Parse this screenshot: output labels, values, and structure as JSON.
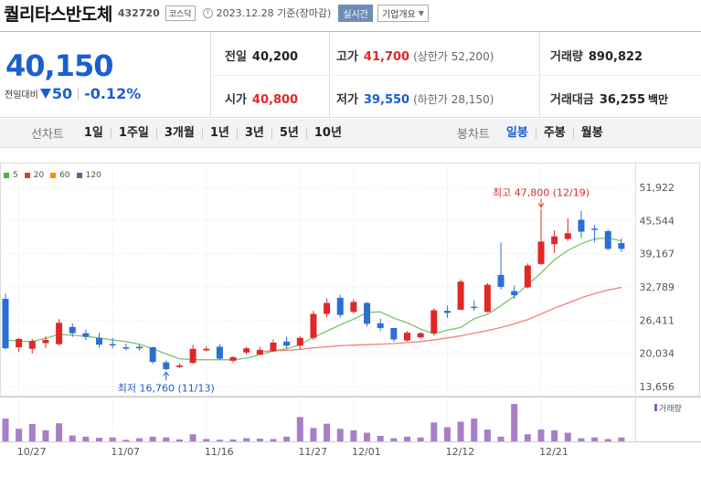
{
  "header": {
    "stock_name": "퀄리타스반도체",
    "stock_code": "432720",
    "market": "코스닥",
    "date_text": "2023.12.28 기준(장마감)",
    "realtime_label": "실시간",
    "company_label": "기업개요"
  },
  "price": {
    "current": "40,150",
    "change_label": "전일대비",
    "change_value": "50",
    "change_pct": "-0.12%"
  },
  "stats": {
    "prev_close_label": "전일",
    "prev_close": "40,200",
    "high_label": "고가",
    "high": "41,700",
    "upper_limit": "(상한가 52,200)",
    "volume_label": "거래량",
    "volume": "890,822",
    "open_label": "시가",
    "open": "40,800",
    "low_label": "저가",
    "low": "39,550",
    "lower_limit": "(하한가 28,150)",
    "amount_label": "거래대금",
    "amount": "36,255",
    "amount_unit": "백만"
  },
  "toolbar": {
    "line_label": "선차트",
    "line_periods": [
      "1일",
      "1주일",
      "3개월",
      "1년",
      "3년",
      "5년",
      "10년"
    ],
    "candle_label": "봉차트",
    "candle_periods": [
      "일봉",
      "주봉",
      "월봉"
    ],
    "active_candle": "일봉"
  },
  "legend": [
    {
      "label": "5",
      "color": "#4caf50"
    },
    {
      "label": "20",
      "color": "#e53935"
    },
    {
      "label": "60",
      "color": "#fb8c00"
    },
    {
      "label": "120",
      "color": "#8e44ad"
    }
  ],
  "colors": {
    "up": "#e02828",
    "down": "#2a6fd6",
    "ma5": "#7ec26b",
    "ma20": "#f08080"
  },
  "chart_data": {
    "type": "candlestick",
    "y_ticks": [
      51922,
      45544,
      39167,
      32789,
      26411,
      20034,
      13656
    ],
    "y_tick_labels": [
      "51,922",
      "45,544",
      "39,167",
      "32,789",
      "26,411",
      "20,034",
      "13,656"
    ],
    "ylim": [
      13656,
      51922
    ],
    "x_labels": [
      {
        "label": "10/27",
        "index": 1
      },
      {
        "label": "11/07",
        "index": 8
      },
      {
        "label": "11/16",
        "index": 15
      },
      {
        "label": "11/27",
        "index": 22
      },
      {
        "label": "12/01",
        "index": 26
      },
      {
        "label": "12/12",
        "index": 33
      },
      {
        "label": "12/21",
        "index": 40
      }
    ],
    "candles": [
      {
        "o": 30500,
        "h": 31500,
        "l": 20800,
        "c": 21000
      },
      {
        "o": 21200,
        "h": 23000,
        "l": 20300,
        "c": 22800
      },
      {
        "o": 20900,
        "h": 22800,
        "l": 20000,
        "c": 22400
      },
      {
        "o": 22000,
        "h": 23300,
        "l": 21000,
        "c": 22600
      },
      {
        "o": 21800,
        "h": 26600,
        "l": 21500,
        "c": 25900
      },
      {
        "o": 25100,
        "h": 25800,
        "l": 23200,
        "c": 23900
      },
      {
        "o": 23900,
        "h": 24600,
        "l": 22600,
        "c": 23200
      },
      {
        "o": 23000,
        "h": 24000,
        "l": 21100,
        "c": 21700
      },
      {
        "o": 21800,
        "h": 23000,
        "l": 21000,
        "c": 21600
      },
      {
        "o": 21200,
        "h": 21900,
        "l": 20600,
        "c": 21000
      },
      {
        "o": 21300,
        "h": 21700,
        "l": 20600,
        "c": 21000
      },
      {
        "o": 21200,
        "h": 21300,
        "l": 18000,
        "c": 18400
      },
      {
        "o": 18300,
        "h": 18700,
        "l": 16760,
        "c": 17000
      },
      {
        "o": 17400,
        "h": 18100,
        "l": 17200,
        "c": 17700
      },
      {
        "o": 18200,
        "h": 21700,
        "l": 18000,
        "c": 20900
      },
      {
        "o": 20600,
        "h": 21400,
        "l": 20400,
        "c": 20900
      },
      {
        "o": 21300,
        "h": 21800,
        "l": 18800,
        "c": 19000
      },
      {
        "o": 18600,
        "h": 19500,
        "l": 18200,
        "c": 19300
      },
      {
        "o": 20200,
        "h": 21300,
        "l": 19800,
        "c": 21000
      },
      {
        "o": 19800,
        "h": 21300,
        "l": 19700,
        "c": 20700
      },
      {
        "o": 20400,
        "h": 22700,
        "l": 20300,
        "c": 22100
      },
      {
        "o": 22300,
        "h": 23200,
        "l": 21000,
        "c": 21500
      },
      {
        "o": 21500,
        "h": 23300,
        "l": 20900,
        "c": 23000
      },
      {
        "o": 23000,
        "h": 28200,
        "l": 22600,
        "c": 27600
      },
      {
        "o": 27600,
        "h": 30600,
        "l": 27000,
        "c": 29700
      },
      {
        "o": 30700,
        "h": 31300,
        "l": 26900,
        "c": 27400
      },
      {
        "o": 28000,
        "h": 30400,
        "l": 27700,
        "c": 29900
      },
      {
        "o": 29700,
        "h": 29900,
        "l": 25200,
        "c": 25700
      },
      {
        "o": 25800,
        "h": 26700,
        "l": 24300,
        "c": 24900
      },
      {
        "o": 24900,
        "h": 24900,
        "l": 22300,
        "c": 22700
      },
      {
        "o": 22500,
        "h": 24300,
        "l": 22300,
        "c": 24000
      },
      {
        "o": 23100,
        "h": 24100,
        "l": 22900,
        "c": 23900
      },
      {
        "o": 23900,
        "h": 28700,
        "l": 23500,
        "c": 28300
      },
      {
        "o": 28200,
        "h": 29200,
        "l": 26800,
        "c": 27800
      },
      {
        "o": 28400,
        "h": 34200,
        "l": 28400,
        "c": 33800
      },
      {
        "o": 29000,
        "h": 30200,
        "l": 28200,
        "c": 28800
      },
      {
        "o": 28000,
        "h": 33500,
        "l": 27800,
        "c": 33200
      },
      {
        "o": 35100,
        "h": 41300,
        "l": 32300,
        "c": 32800
      },
      {
        "o": 32000,
        "h": 33100,
        "l": 30500,
        "c": 31200
      },
      {
        "o": 32700,
        "h": 37300,
        "l": 32500,
        "c": 36900
      },
      {
        "o": 37200,
        "h": 47800,
        "l": 37000,
        "c": 41500
      },
      {
        "o": 41000,
        "h": 43700,
        "l": 39300,
        "c": 42500
      },
      {
        "o": 42000,
        "h": 46000,
        "l": 41600,
        "c": 43100
      },
      {
        "o": 45700,
        "h": 47400,
        "l": 42200,
        "c": 43400
      },
      {
        "o": 44000,
        "h": 44700,
        "l": 41400,
        "c": 43900
      },
      {
        "o": 43500,
        "h": 43800,
        "l": 39800,
        "c": 40100
      },
      {
        "o": 41200,
        "h": 42100,
        "l": 39500,
        "c": 40100
      }
    ],
    "ma5": [
      22600,
      22400,
      22300,
      22900,
      23700,
      23500,
      23300,
      23000,
      22600,
      22300,
      21800,
      20900,
      19900,
      19000,
      18800,
      18800,
      18800,
      18800,
      19100,
      19800,
      20500,
      20900,
      21700,
      23100,
      24300,
      25500,
      26600,
      27900,
      28000,
      26800,
      25900,
      24700,
      23800,
      24500,
      25000,
      26700,
      27500,
      29200,
      31000,
      33200,
      35500,
      38000,
      39800,
      41100,
      42000,
      42200,
      41600
    ],
    "ma20": [
      null,
      null,
      null,
      null,
      null,
      null,
      null,
      null,
      null,
      null,
      null,
      null,
      null,
      null,
      null,
      null,
      null,
      null,
      null,
      20400,
      20500,
      20600,
      20800,
      21100,
      21300,
      21500,
      21600,
      21700,
      21800,
      21900,
      22100,
      22300,
      22600,
      23000,
      23400,
      23900,
      24400,
      25000,
      25700,
      26500,
      27600,
      28700,
      29700,
      30700,
      31500,
      32200,
      32700
    ],
    "volume": [
      0.58,
      0.32,
      0.44,
      0.28,
      0.46,
      0.15,
      0.12,
      0.09,
      0.1,
      0.04,
      0.08,
      0.12,
      0.1,
      0.05,
      0.18,
      0.06,
      0.04,
      0.05,
      0.08,
      0.07,
      0.06,
      0.12,
      0.62,
      0.34,
      0.45,
      0.32,
      0.28,
      0.22,
      0.14,
      0.08,
      0.12,
      0.1,
      0.48,
      0.36,
      0.5,
      0.58,
      0.3,
      0.12,
      0.95,
      0.18,
      0.3,
      0.28,
      0.22,
      0.08,
      0.1,
      0.06,
      0.1
    ],
    "volume_label": "거래량",
    "annotations": {
      "high_label": "최고 47,800 (12/19)",
      "high_index": 40,
      "high_value": 47800,
      "low_label": "최저 16,760 (11/13)",
      "low_index": 12,
      "low_value": 16760
    }
  }
}
